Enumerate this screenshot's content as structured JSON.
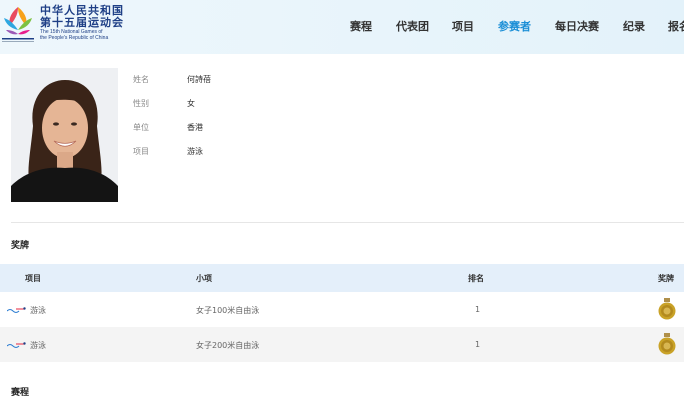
{
  "header": {
    "brand": {
      "cn_line1": "中华人民共和国",
      "cn_line2": "第十五届运动会",
      "en_line1": "The 15th National Games of",
      "en_line2": "the People's Republic of China"
    },
    "nav": [
      {
        "label": "赛程",
        "active": false
      },
      {
        "label": "代表团",
        "active": false
      },
      {
        "label": "项目",
        "active": false
      },
      {
        "label": "参赛者",
        "active": true
      },
      {
        "label": "每日决赛",
        "active": false
      },
      {
        "label": "纪录",
        "active": false
      },
      {
        "label": "报名",
        "active": false
      }
    ]
  },
  "profile": {
    "fields": [
      {
        "label": "姓名",
        "value": "何詩蓓"
      },
      {
        "label": "性别",
        "value": "女"
      },
      {
        "label": "单位",
        "value": "香港"
      },
      {
        "label": "项目",
        "value": "游泳"
      }
    ]
  },
  "medals": {
    "title": "奖牌",
    "headers": {
      "sport": "项目",
      "event": "小项",
      "rank": "排名",
      "medal": "奖牌"
    },
    "rows": [
      {
        "sport": "游泳",
        "event": "女子100米自由泳",
        "rank": "1",
        "medal": "gold"
      },
      {
        "sport": "游泳",
        "event": "女子200米自由泳",
        "rank": "1",
        "medal": "gold"
      }
    ]
  },
  "next_section_title": "赛程",
  "colors": {
    "accent": "#1a8ed6",
    "brand": "#1e3f86",
    "gold": "#c9a227",
    "table_header": "#e4effa"
  }
}
